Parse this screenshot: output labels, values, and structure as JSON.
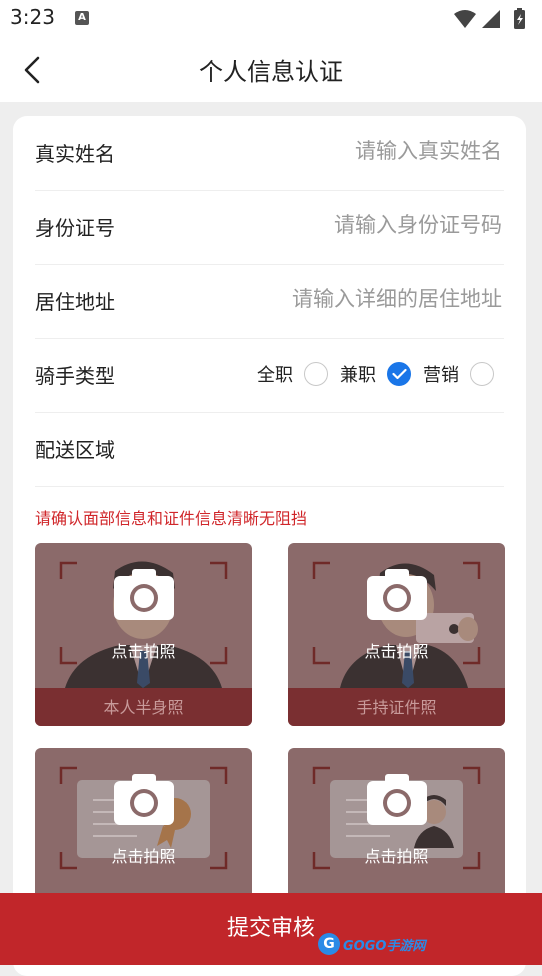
{
  "status_bar": {
    "time": "3:23",
    "notification_icon": "a-icon",
    "icons": [
      "wifi-icon",
      "cellular-icon",
      "battery-icon"
    ]
  },
  "header": {
    "title": "个人信息认证",
    "back_icon": "chevron-left-icon"
  },
  "form": {
    "name": {
      "label": "真实姓名",
      "placeholder": "请输入真实姓名",
      "value": ""
    },
    "id_number": {
      "label": "身份证号",
      "placeholder": "请输入身份证号码",
      "value": ""
    },
    "address": {
      "label": "居住地址",
      "placeholder": "请输入详细的居住地址",
      "value": ""
    },
    "rider_type": {
      "label": "骑手类型",
      "options": [
        {
          "label": "全职",
          "checked": false
        },
        {
          "label": "兼职",
          "checked": true
        },
        {
          "label": "营销",
          "checked": false
        }
      ]
    },
    "delivery_area": {
      "label": "配送区域",
      "value": ""
    }
  },
  "warning": "请确认面部信息和证件信息清晰无阻挡",
  "photos": [
    {
      "caption": "本人半身照",
      "tap_label": "点击拍照",
      "icon": "camera-icon"
    },
    {
      "caption": "手持证件照",
      "tap_label": "点击拍照",
      "icon": "camera-icon"
    },
    {
      "caption": "",
      "tap_label": "点击拍照",
      "icon": "camera-icon"
    },
    {
      "caption": "",
      "tap_label": "点击拍照",
      "icon": "camera-icon"
    }
  ],
  "submit_label": "提交审核",
  "watermark": {
    "logo": "G",
    "text": "GOGO手游网"
  },
  "colors": {
    "accent": "#c1262a",
    "warning": "#d0262a",
    "checked": "#1a76e8",
    "placeholder": "#9a9a9a",
    "photo_overlay": "#8b6a6a",
    "photo_caption_bg": "#7a2f31"
  }
}
